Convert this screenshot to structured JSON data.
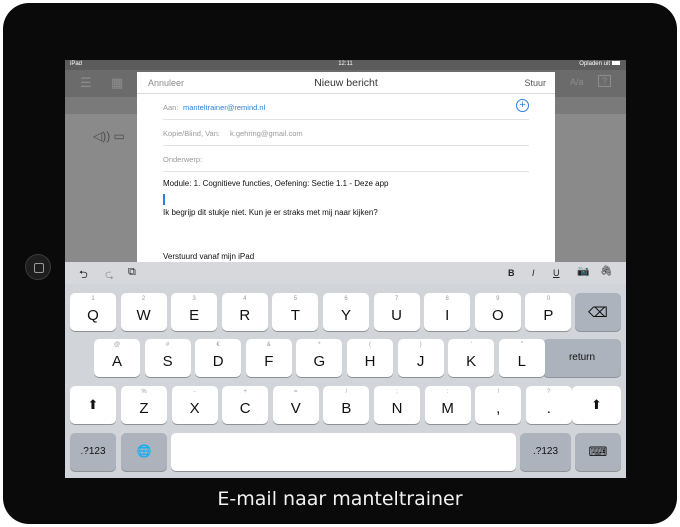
{
  "statusbar": {
    "device": "iPad",
    "time": "12:11",
    "charging": "Opladen uit"
  },
  "compose": {
    "cancel_label": "Annuleer",
    "title": "Nieuw bericht",
    "send_label": "Stuur",
    "to_label": "Aan:",
    "to_value": "manteltrainer@remind.nl",
    "add_icon": "+",
    "cc_label": "Kopie/Blind, Van:",
    "cc_value": "k.gehring@gmail.com",
    "subject_label": "Onderwerp:",
    "subject_value": "",
    "body_line1": "Module: 1. Cognitieve functies, Oefening: Sectie 1.1 - Deze app",
    "body_line2": "Ik begrijp dit stukje niet. Kun je er straks met mij naar kijken?",
    "signature": "Verstuurd vanaf mijn iPad"
  },
  "background_app": {
    "font_button": "A/a",
    "help_button": "?"
  },
  "keyboard": {
    "toolbar": {
      "undo": "⮌",
      "redo": "⮎",
      "paste": "⧉",
      "bold": "B",
      "italic": "I",
      "underline": "U",
      "camera": "📷",
      "attach": "🖇"
    },
    "row1": [
      {
        "key": "Q",
        "hint": "1"
      },
      {
        "key": "W",
        "hint": "2"
      },
      {
        "key": "E",
        "hint": "3"
      },
      {
        "key": "R",
        "hint": "4"
      },
      {
        "key": "T",
        "hint": "5"
      },
      {
        "key": "Y",
        "hint": "6"
      },
      {
        "key": "U",
        "hint": "7"
      },
      {
        "key": "I",
        "hint": "8"
      },
      {
        "key": "O",
        "hint": "9"
      },
      {
        "key": "P",
        "hint": "0"
      }
    ],
    "row2": [
      {
        "key": "A",
        "hint": "@"
      },
      {
        "key": "S",
        "hint": "#"
      },
      {
        "key": "D",
        "hint": "€"
      },
      {
        "key": "F",
        "hint": "&"
      },
      {
        "key": "G",
        "hint": "*"
      },
      {
        "key": "H",
        "hint": "("
      },
      {
        "key": "J",
        "hint": ")"
      },
      {
        "key": "K",
        "hint": "'"
      },
      {
        "key": "L",
        "hint": "\""
      }
    ],
    "row3": [
      {
        "key": "Z",
        "hint": "%"
      },
      {
        "key": "X",
        "hint": "-"
      },
      {
        "key": "C",
        "hint": "+"
      },
      {
        "key": "V",
        "hint": "="
      },
      {
        "key": "B",
        "hint": "/"
      },
      {
        "key": "N",
        "hint": ";"
      },
      {
        "key": "M",
        "hint": ":"
      },
      {
        "key": ",",
        "hint": "!"
      },
      {
        "key": ".",
        "hint": "?"
      }
    ],
    "delete": "⌫",
    "return_label": "return",
    "shift": "⬆",
    "numbers_label": ".?123",
    "globe": "🌐",
    "hide_keyboard": "⌨"
  },
  "caption": "E-mail naar manteltrainer"
}
